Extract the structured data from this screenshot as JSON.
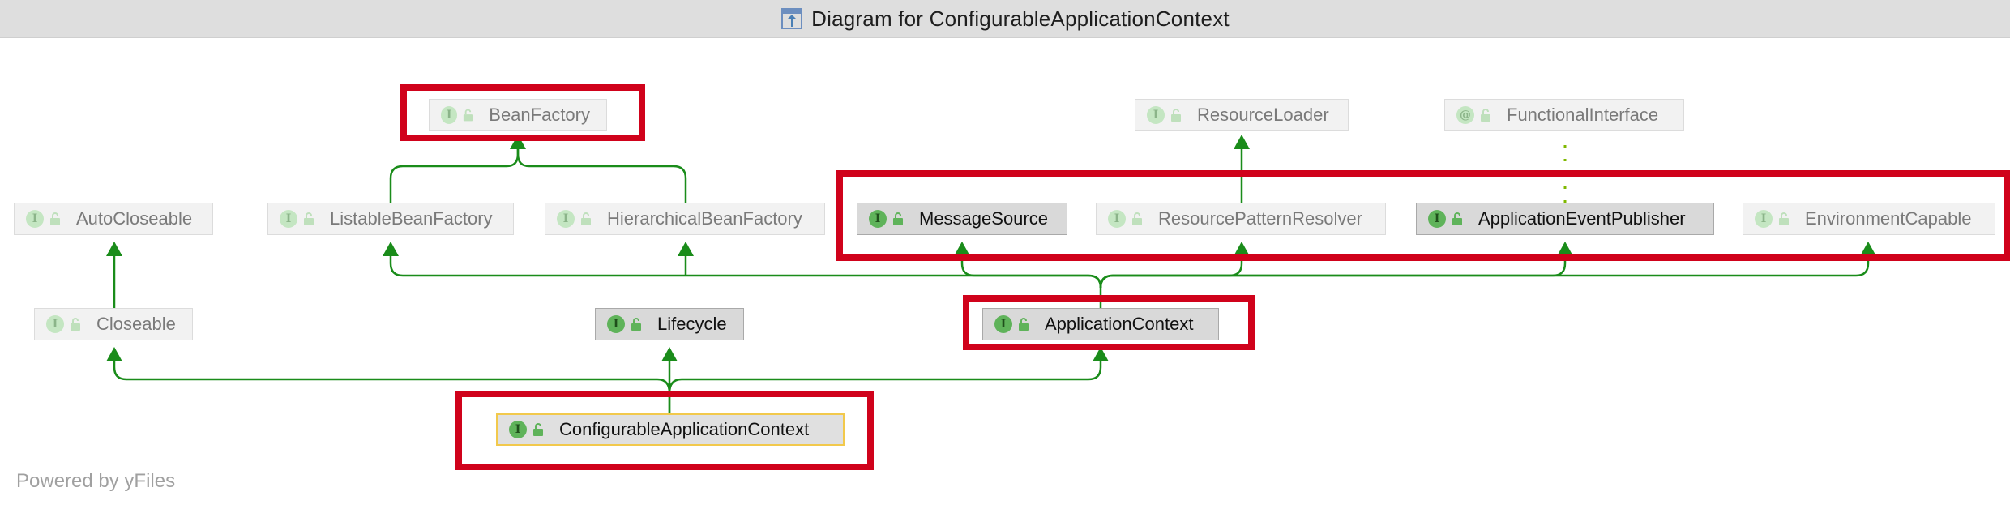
{
  "window": {
    "title": "Diagram for ConfigurableApplicationContext",
    "title_icon": "diagram-icon"
  },
  "colors": {
    "edge": "#1a8c1a",
    "highlight": "#d0021b",
    "realization": "#7fb800",
    "focus_border": "#f2c94c"
  },
  "nodes": {
    "bean_factory": {
      "badge": "I",
      "label": "BeanFactory"
    },
    "resource_loader": {
      "badge": "I",
      "label": "ResourceLoader"
    },
    "functional_interface": {
      "badge": "@",
      "label": "FunctionalInterface"
    },
    "auto_closeable": {
      "badge": "I",
      "label": "AutoCloseable"
    },
    "listable_bean_factory": {
      "badge": "I",
      "label": "ListableBeanFactory"
    },
    "hierarchical_bean_factory": {
      "badge": "I",
      "label": "HierarchicalBeanFactory"
    },
    "message_source": {
      "badge": "I",
      "label": "MessageSource"
    },
    "resource_pattern_resolver": {
      "badge": "I",
      "label": "ResourcePatternResolver"
    },
    "application_event_publisher": {
      "badge": "I",
      "label": "ApplicationEventPublisher"
    },
    "environment_capable": {
      "badge": "I",
      "label": "EnvironmentCapable"
    },
    "closeable": {
      "badge": "I",
      "label": "Closeable"
    },
    "lifecycle": {
      "badge": "I",
      "label": "Lifecycle"
    },
    "application_context": {
      "badge": "I",
      "label": "ApplicationContext"
    },
    "configurable_application_context": {
      "badge": "I",
      "label": "ConfigurableApplicationContext"
    }
  },
  "footer": {
    "text": "Powered by yFiles"
  }
}
